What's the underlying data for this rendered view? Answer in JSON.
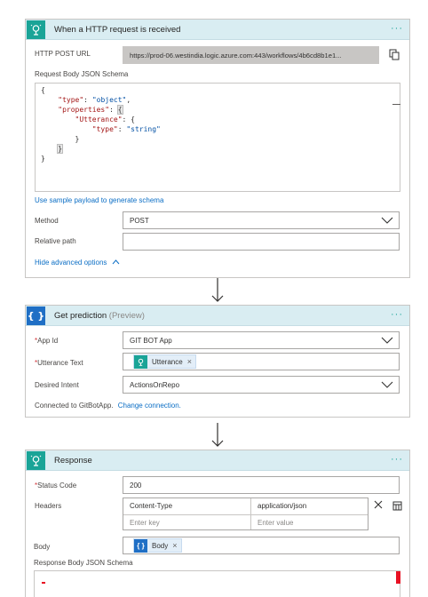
{
  "trigger": {
    "title": "When a HTTP request is received",
    "icon": "http-request-icon",
    "post_url_label": "HTTP POST URL",
    "post_url_value": "https://prod-06.westindia.logic.azure.com:443/workflows/4b6cd8b1e1...",
    "schema_label": "Request Body JSON Schema",
    "schema_lines": [
      "{",
      "\"type\"",
      ": ",
      "\"object\"",
      ",",
      "\"properties\"",
      ": {",
      "\"Utterance\"",
      ": {",
      "\"type\"",
      ": ",
      "\"string\"",
      "}",
      "}",
      "}"
    ],
    "sample_payload_link": "Use sample payload to generate schema",
    "method_label": "Method",
    "method_value": "POST",
    "relative_path_label": "Relative path",
    "relative_path_value": "",
    "hide_advanced": "Hide advanced options"
  },
  "prediction": {
    "title": "Get prediction",
    "title_suffix": "(Preview)",
    "icon": "braces-icon",
    "app_id_label": "App Id",
    "app_id_value": "GIT BOT App",
    "utterance_label": "Utterance Text",
    "utterance_token": "Utterance",
    "intent_label": "Desired Intent",
    "intent_value": "ActionsOnRepo",
    "connected_text": "Connected to GitBotApp.",
    "change_connection": "Change connection."
  },
  "response": {
    "title": "Response",
    "icon": "http-response-icon",
    "status_label": "Status Code",
    "status_value": "200",
    "headers_label": "Headers",
    "headers": [
      {
        "key": "Content-Type",
        "value": "application/json"
      }
    ],
    "header_key_placeholder": "Enter key",
    "header_value_placeholder": "Enter value",
    "body_label": "Body",
    "body_token": "Body",
    "schema_label": "Response Body JSON Schema"
  },
  "required_mark": "*",
  "more_glyph": "···",
  "token_close": "×",
  "colors": {
    "header_bg": "#d9edf2",
    "trigger_accent": "#1aa497",
    "action_accent": "#1f6fc5",
    "link": "#0b6ec5",
    "required": "#d13438"
  }
}
